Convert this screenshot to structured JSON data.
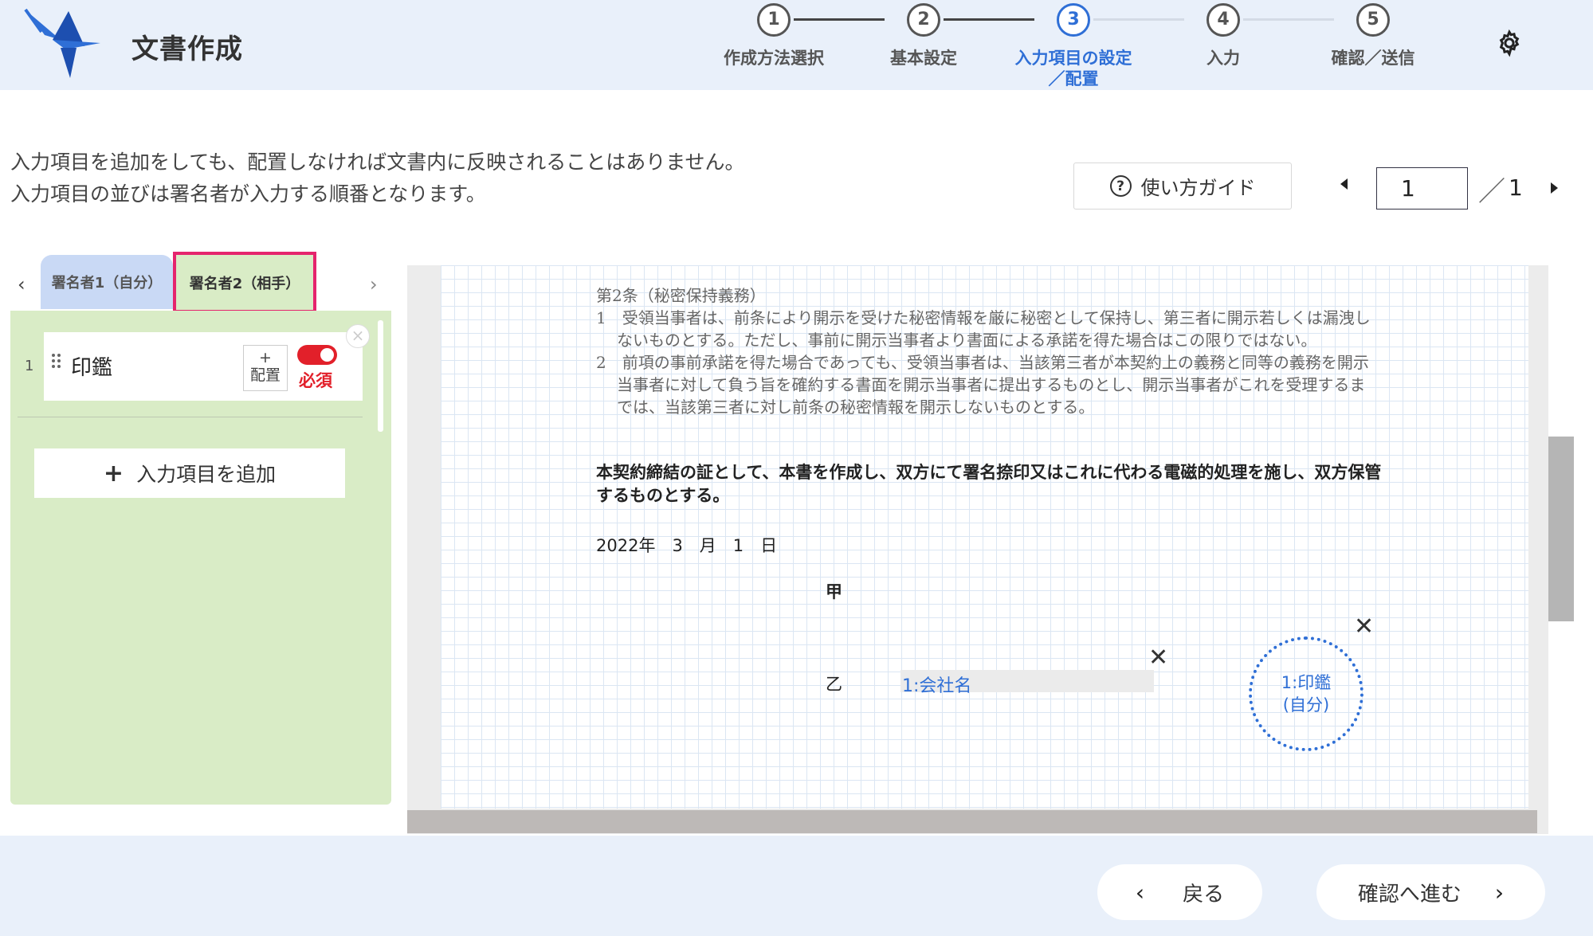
{
  "header": {
    "app_title": "文書作成",
    "steps": [
      {
        "num": "1",
        "label": "作成方法選択"
      },
      {
        "num": "2",
        "label": "基本設定"
      },
      {
        "num": "3",
        "label_line1": "入力項目の設定",
        "label_line2": "／配置"
      },
      {
        "num": "4",
        "label": "入力"
      },
      {
        "num": "5",
        "label": "確認／送信"
      }
    ],
    "active_step": 3
  },
  "instructions": {
    "line1": "入力項目を追加をしても、配置しなければ文書内に反映されることはありません。",
    "line2": "入力項目の並びは署名者が入力する順番となります。"
  },
  "guide_button": "使い方ガイド",
  "pager": {
    "current": "1",
    "slash": "／",
    "total": "1"
  },
  "signer_tabs": [
    {
      "label": "署名者1（自分）"
    },
    {
      "label": "署名者2（相手）",
      "selected": true
    }
  ],
  "fields": [
    {
      "index": "1",
      "name": "印鑑",
      "place_label_plus": "+",
      "place_label": "配置",
      "required_label": "必須",
      "required": true
    }
  ],
  "add_field_button": "入力項目を追加",
  "document": {
    "article_title": "第2条（秘密保持義務）",
    "para1": "1　受領当事者は、前条により開示を受けた秘密情報を厳に秘密として保持し、第三者に開示若しくは漏洩しないものとする。ただし、事前に開示当事者より書面による承諾を得た場合はこの限りではない。",
    "para2": "2　前項の事前承諾を得た場合であっても、受領当事者は、当該第三者が本契約上の義務と同等の義務を開示当事者に対して負う旨を確約する書面を開示当事者に提出するものとし、開示当事者がこれを受理するまでは、当該第三者に対し前条の秘密情報を開示しないものとする。",
    "closing": "本契約締結の証として、本書を作成し、双方にて署名捺印又はこれに代わる電磁的処理を施し、双方保管するものとする。",
    "date": "2022年　3　月　1　日",
    "party_a": "甲",
    "party_b": "乙",
    "company_field": "1:会社名",
    "seal_line1": "1:印鑑",
    "seal_line2": "(自分)"
  },
  "footer": {
    "back": "戻る",
    "next": "確認へ進む"
  },
  "colors": {
    "accent": "#2f6fd6",
    "header_bg": "#e9f0fa",
    "panel_bg": "#d9ecc6",
    "tab_active_outline": "#e5246d",
    "required_red": "#e2202a"
  }
}
